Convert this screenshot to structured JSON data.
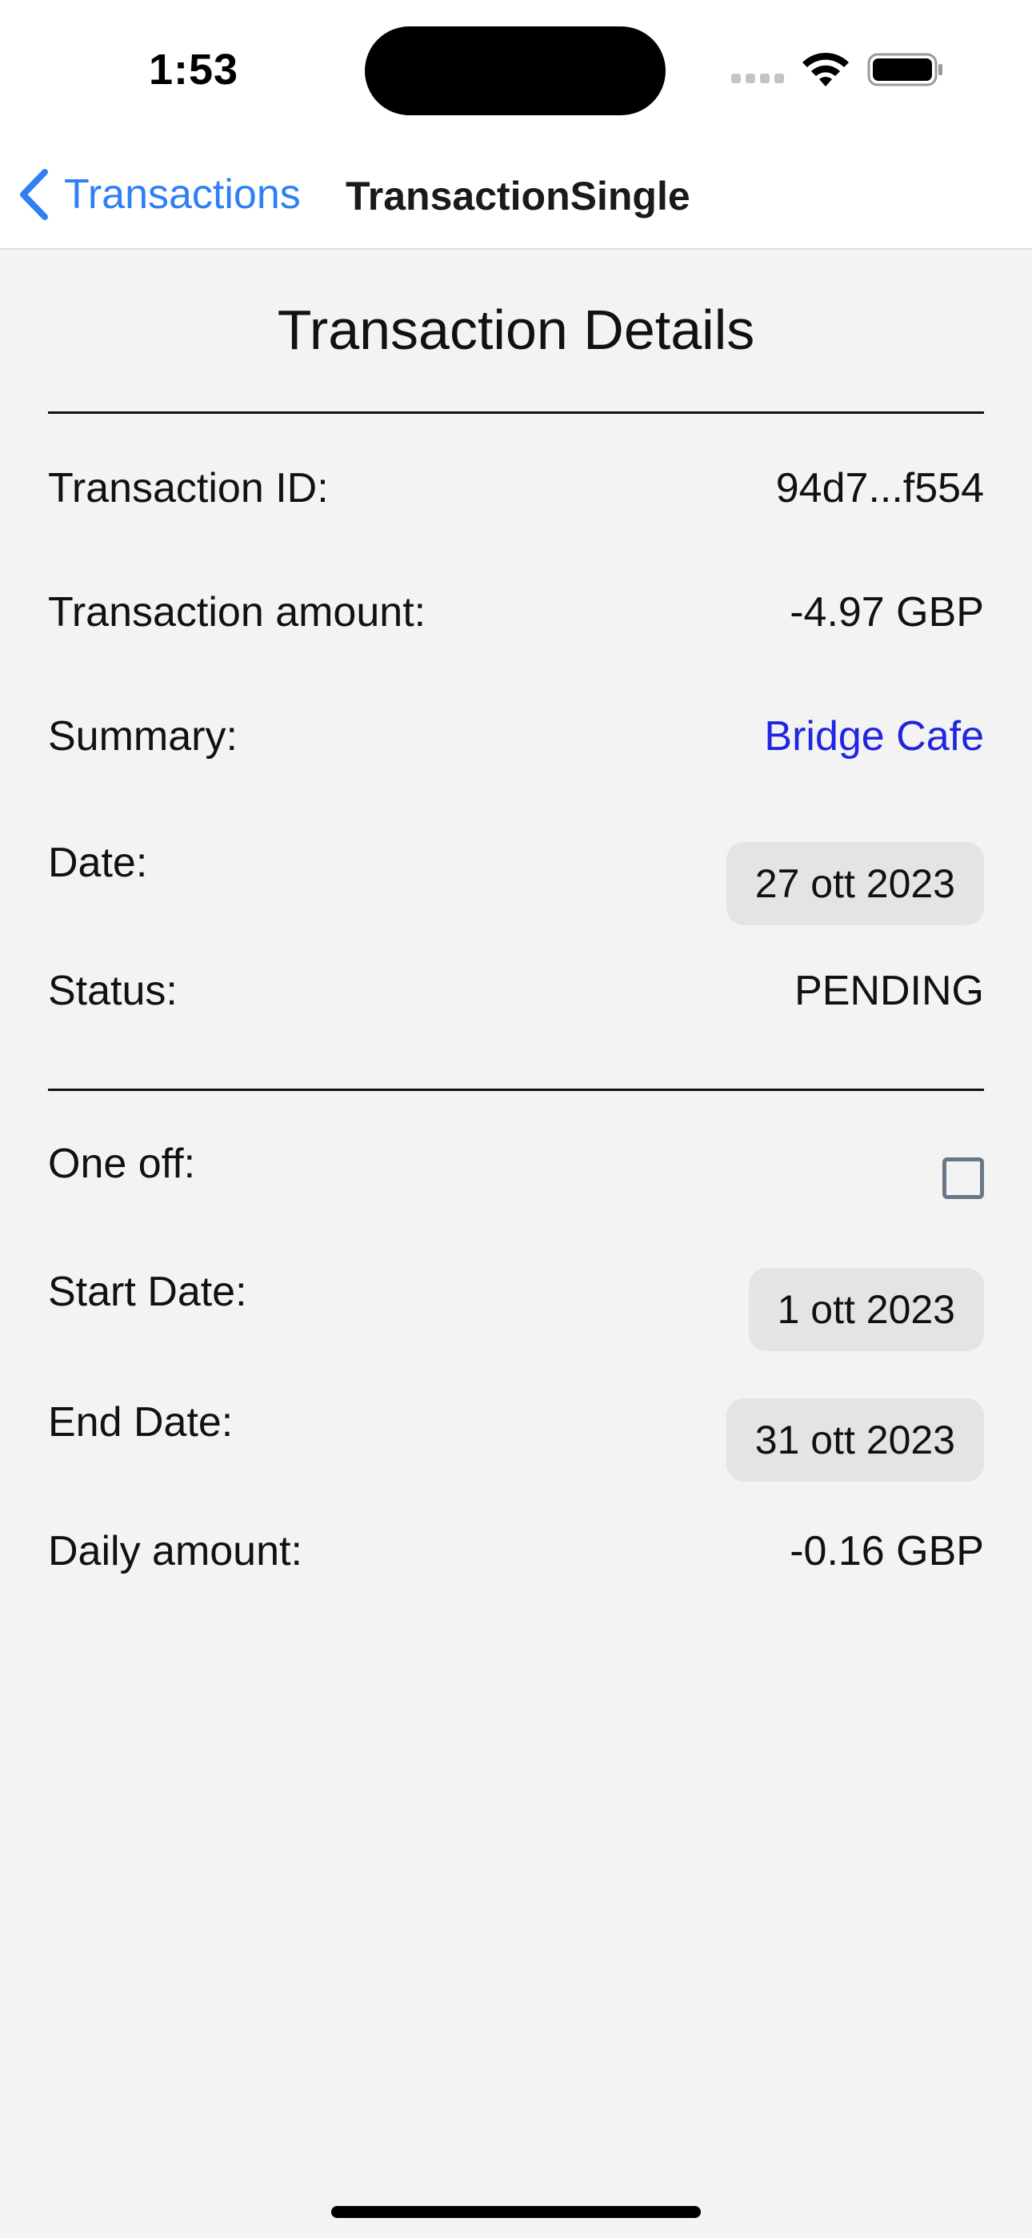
{
  "status_bar": {
    "time": "1:53"
  },
  "nav": {
    "back_label": "Transactions",
    "title": "TransactionSingle"
  },
  "details": {
    "title": "Transaction Details",
    "transaction_id_label": "Transaction ID:",
    "transaction_id_value": "94d7...f554",
    "amount_label": "Transaction amount:",
    "amount_value": "-4.97 GBP",
    "summary_label": "Summary:",
    "summary_value": "Bridge Cafe",
    "date_label": "Date:",
    "date_value": "27 ott 2023",
    "status_label": "Status:",
    "status_value": "PENDING"
  },
  "schedule": {
    "one_off_label": "One off:",
    "one_off_checked": false,
    "start_date_label": "Start Date:",
    "start_date_value": "1 ott 2023",
    "end_date_label": "End Date:",
    "end_date_value": "31 ott 2023",
    "daily_amount_label": "Daily amount:",
    "daily_amount_value": "-0.16 GBP"
  },
  "colors": {
    "accent": "#2f7ff5",
    "link": "#1f25e0",
    "background": "#f3f3f3",
    "pill": "#e4e4e4"
  }
}
